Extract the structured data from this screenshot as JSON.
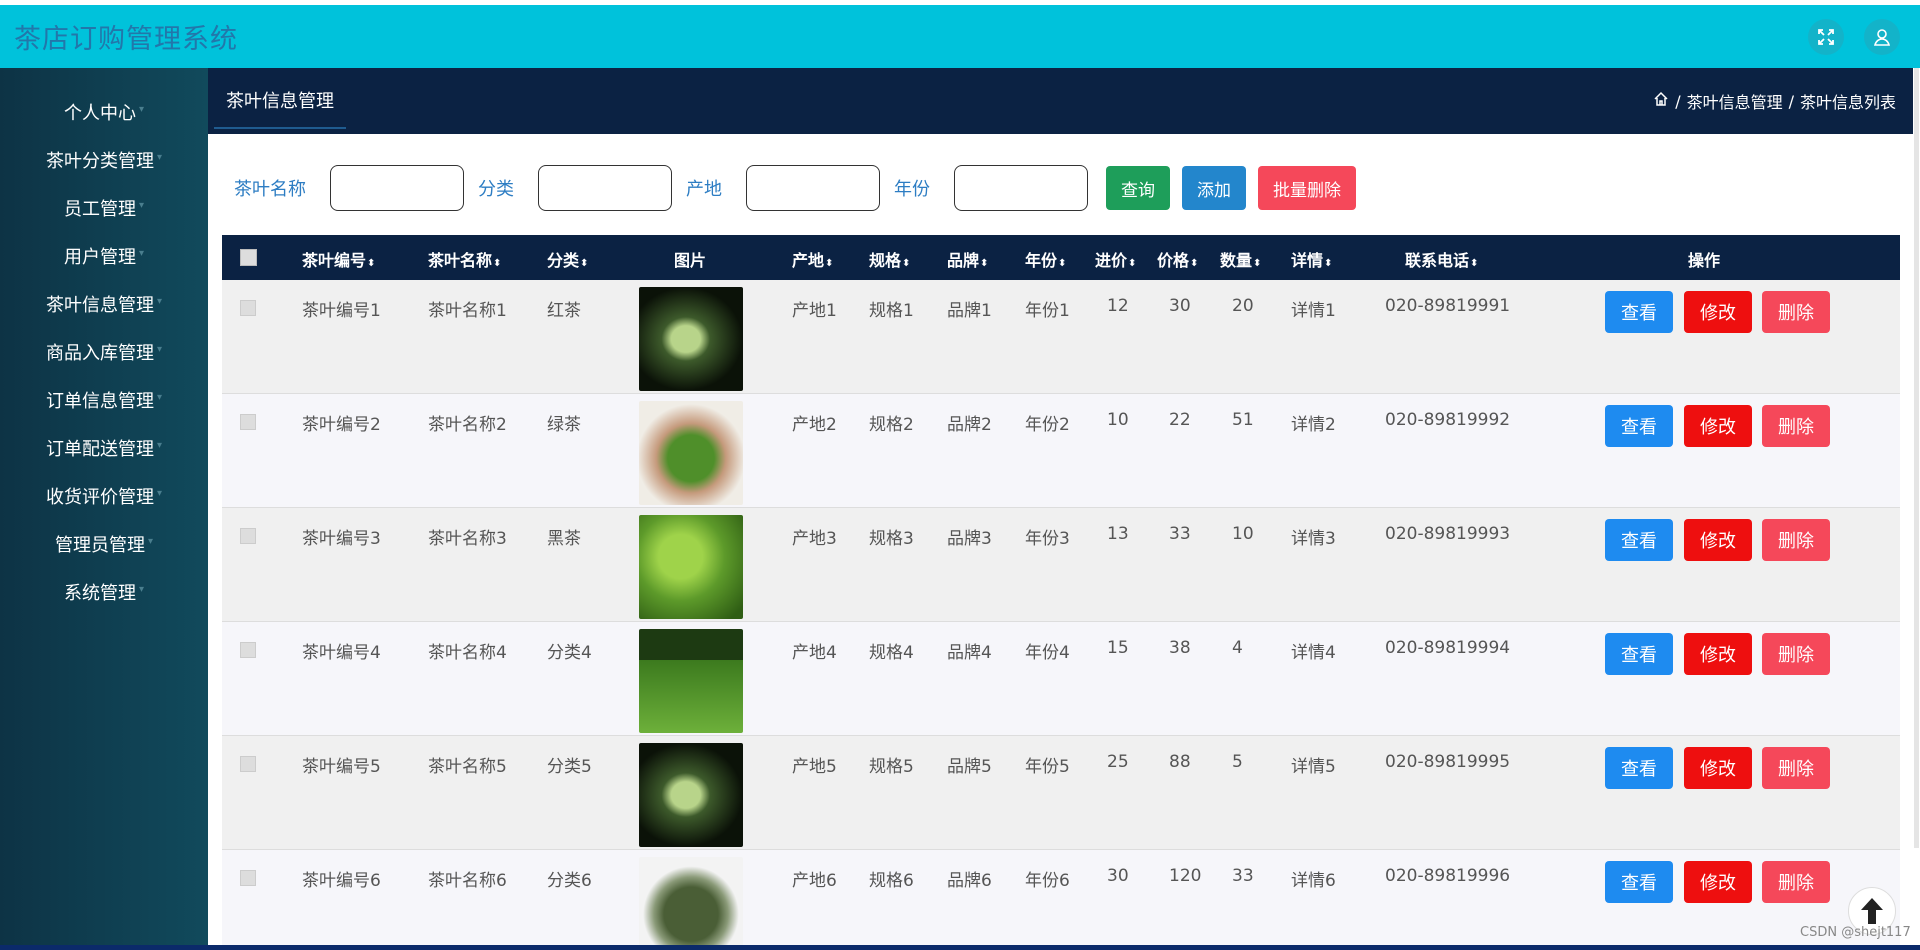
{
  "app": {
    "title": "茶店订购管理系统"
  },
  "topbar": {
    "fullscreen_icon": "expand-icon",
    "user_icon": "user-icon"
  },
  "sidebar": {
    "items": [
      {
        "label": "个人中心"
      },
      {
        "label": "茶叶分类管理"
      },
      {
        "label": "员工管理"
      },
      {
        "label": "用户管理"
      },
      {
        "label": "茶叶信息管理"
      },
      {
        "label": "商品入库管理"
      },
      {
        "label": "订单信息管理"
      },
      {
        "label": "订单配送管理"
      },
      {
        "label": "收货评价管理"
      },
      {
        "label": "管理员管理"
      },
      {
        "label": "系统管理"
      }
    ]
  },
  "page": {
    "tab_title": "茶叶信息管理"
  },
  "breadcrumb": {
    "home_icon": "home-icon",
    "sep": "/",
    "level1": "茶叶信息管理",
    "level2": "茶叶信息列表"
  },
  "search": {
    "name_label": "茶叶名称",
    "name_value": "",
    "category_label": "分类",
    "category_value": "",
    "origin_label": "产地",
    "origin_value": "",
    "year_label": "年份",
    "year_value": "",
    "query_button": "查询",
    "add_button": "添加",
    "batch_delete_button": "批量删除"
  },
  "table": {
    "headers": {
      "code": "茶叶编号",
      "name": "茶叶名称",
      "category": "分类",
      "image": "图片",
      "origin": "产地",
      "spec": "规格",
      "brand": "品牌",
      "year": "年份",
      "cost": "进价",
      "price": "价格",
      "qty": "数量",
      "detail": "详情",
      "phone": "联系电话",
      "action": "操作"
    },
    "sort_icon": "sort-icon",
    "action_labels": {
      "view": "查看",
      "edit": "修改",
      "delete": "删除"
    },
    "rows": [
      {
        "code": "茶叶编号1",
        "name": "茶叶名称1",
        "category": "红茶",
        "origin": "产地1",
        "spec": "规格1",
        "brand": "品牌1",
        "year": "年份1",
        "cost": "12",
        "price": "30",
        "qty": "20",
        "detail": "详情1",
        "phone": "020-89819991",
        "image": "tea-glass-photo"
      },
      {
        "code": "茶叶编号2",
        "name": "茶叶名称2",
        "category": "绿茶",
        "origin": "产地2",
        "spec": "规格2",
        "brand": "品牌2",
        "year": "年份2",
        "cost": "10",
        "price": "22",
        "qty": "51",
        "detail": "详情2",
        "phone": "020-89819992",
        "image": "tea-leaves-hands-photo"
      },
      {
        "code": "茶叶编号3",
        "name": "茶叶名称3",
        "category": "黑茶",
        "origin": "产地3",
        "spec": "规格3",
        "brand": "品牌3",
        "year": "年份3",
        "cost": "13",
        "price": "33",
        "qty": "10",
        "detail": "详情3",
        "phone": "020-89819993",
        "image": "tea-plant-photo"
      },
      {
        "code": "茶叶编号4",
        "name": "茶叶名称4",
        "category": "分类4",
        "origin": "产地4",
        "spec": "规格4",
        "brand": "品牌4",
        "year": "年份4",
        "cost": "15",
        "price": "38",
        "qty": "4",
        "detail": "详情4",
        "phone": "020-89819994",
        "image": "tea-field-photo"
      },
      {
        "code": "茶叶编号5",
        "name": "茶叶名称5",
        "category": "分类5",
        "origin": "产地5",
        "spec": "规格5",
        "brand": "品牌5",
        "year": "年份5",
        "cost": "25",
        "price": "88",
        "qty": "5",
        "detail": "详情5",
        "phone": "020-89819995",
        "image": "tea-glass-photo"
      },
      {
        "code": "茶叶编号6",
        "name": "茶叶名称6",
        "category": "分类6",
        "origin": "产地6",
        "spec": "规格6",
        "brand": "品牌6",
        "year": "年份6",
        "cost": "30",
        "price": "120",
        "qty": "33",
        "detail": "详情6",
        "phone": "020-89819996",
        "image": "dried-tea-bowl-photo"
      }
    ]
  },
  "watermark": "CSDN @shejt117",
  "back_to_top_icon": "arrow-up-icon",
  "colors": {
    "topbar": "#00c2db",
    "sidebar": "#0d3345",
    "header": "#0b2243",
    "view": "#1e8bf0",
    "edit": "#ee0f0f",
    "delete": "#f5485a",
    "query": "#1e9e5a",
    "add": "#2386cc"
  }
}
